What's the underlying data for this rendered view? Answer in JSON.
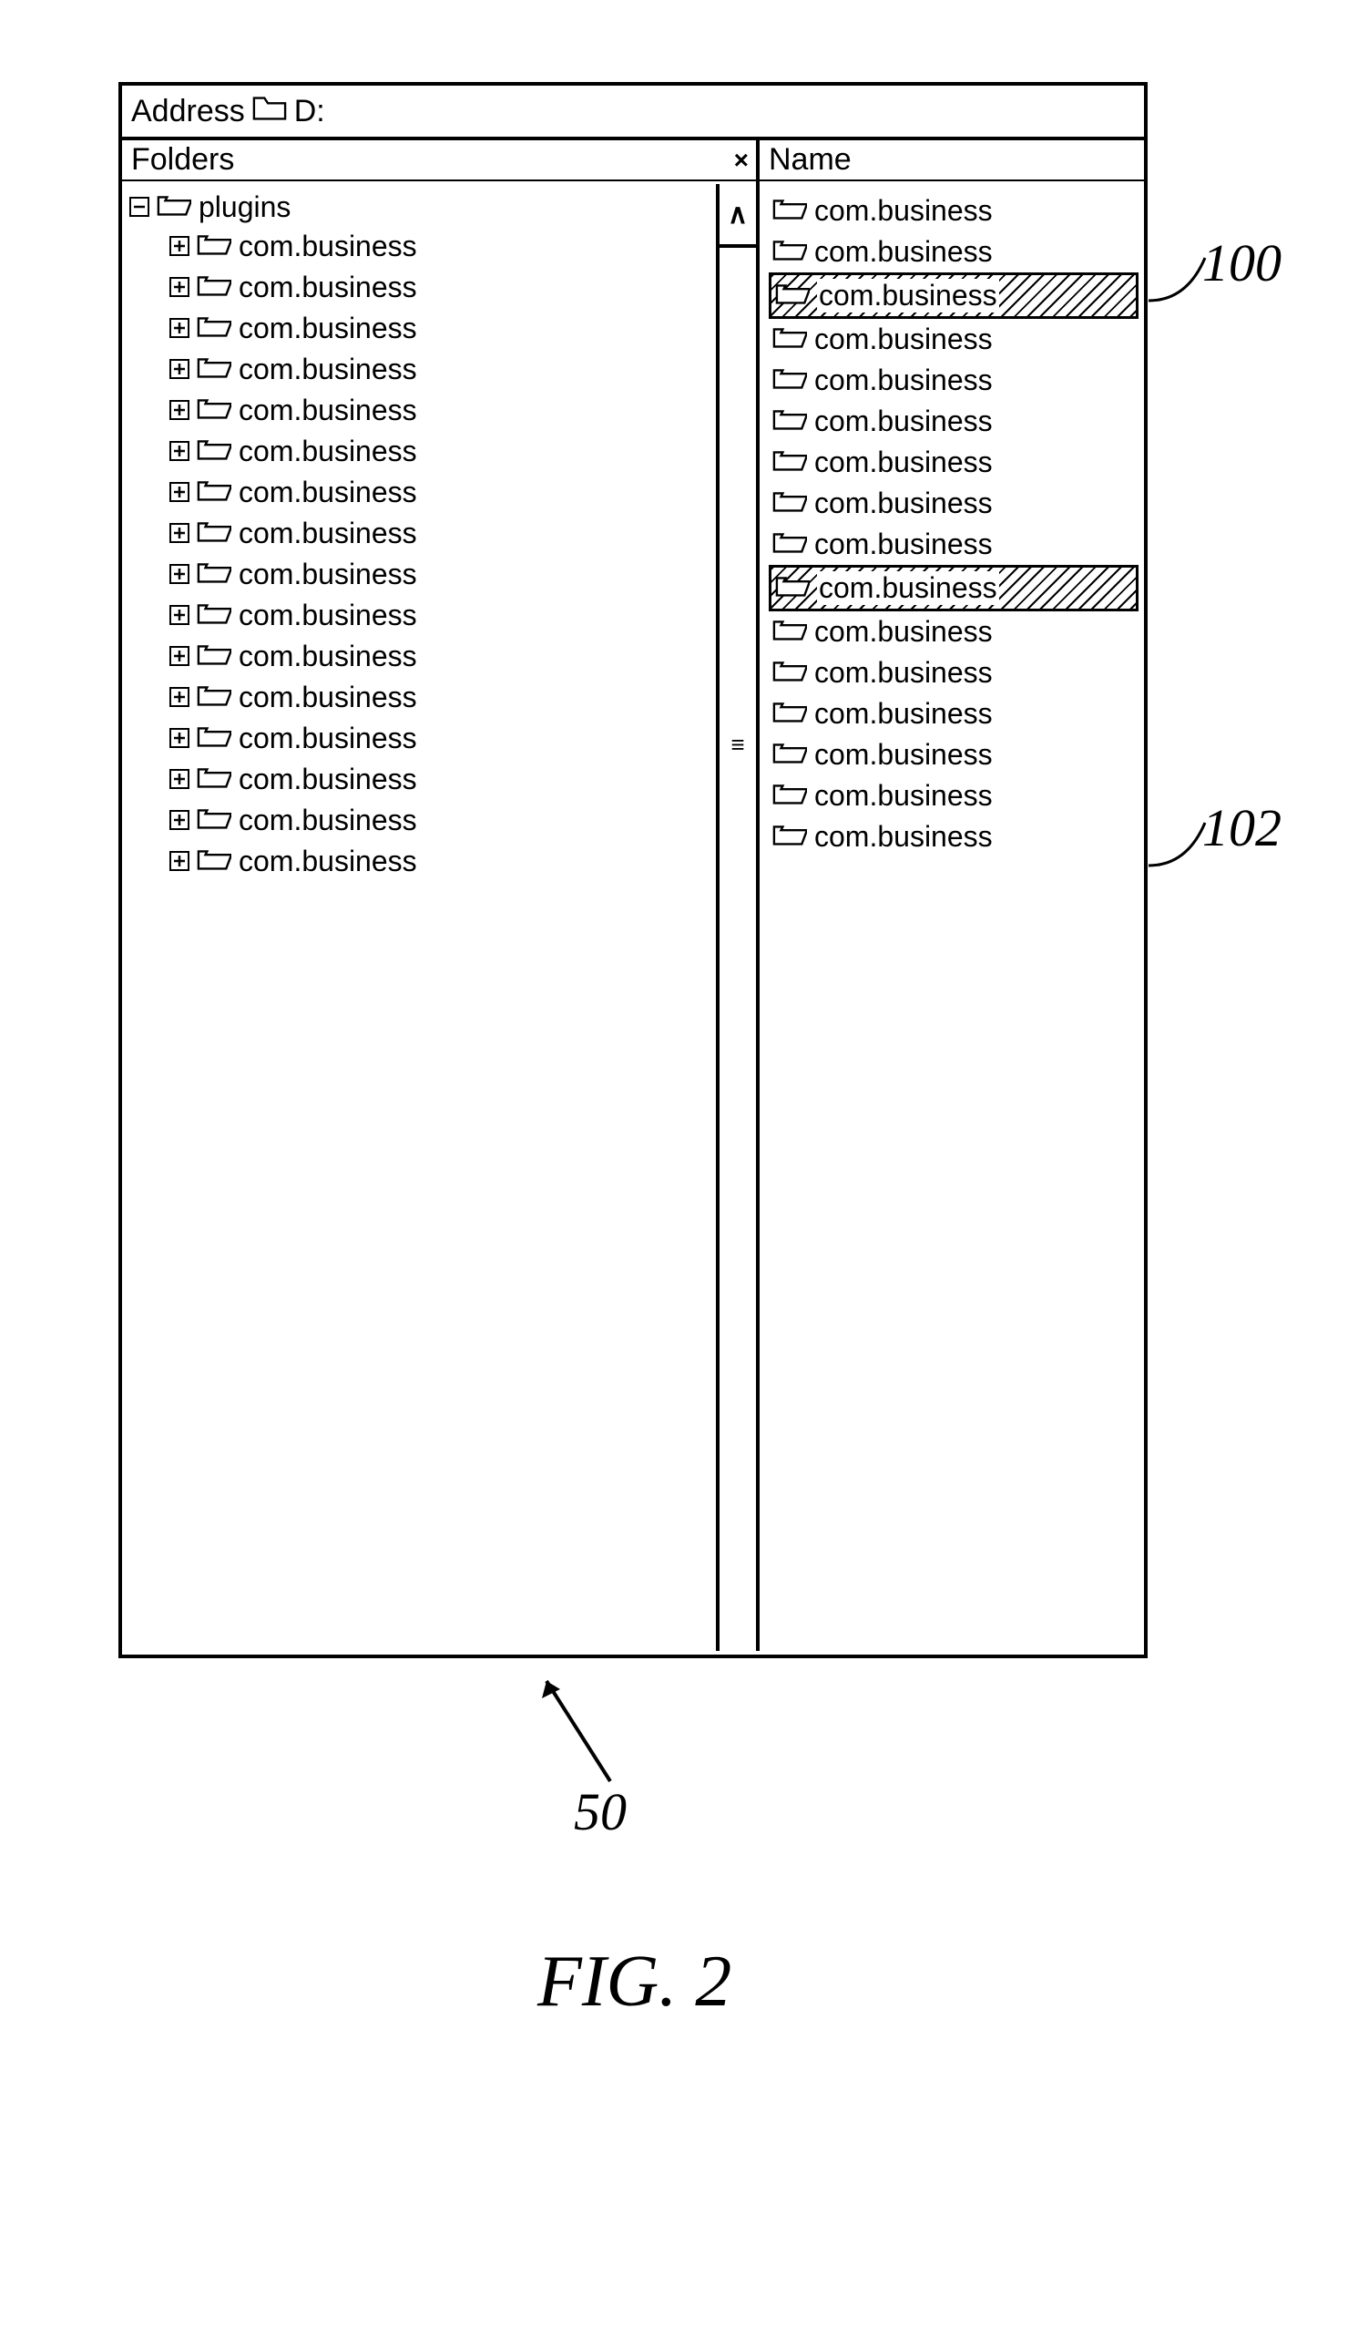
{
  "addressBar": {
    "label": "Address",
    "value": "D:"
  },
  "foldersPane": {
    "header": "Folders",
    "close": "×",
    "root": {
      "name": "plugins",
      "expanded": true
    },
    "children": [
      {
        "name": "com.business"
      },
      {
        "name": "com.business"
      },
      {
        "name": "com.business"
      },
      {
        "name": "com.business"
      },
      {
        "name": "com.business"
      },
      {
        "name": "com.business"
      },
      {
        "name": "com.business"
      },
      {
        "name": "com.business"
      },
      {
        "name": "com.business"
      },
      {
        "name": "com.business"
      },
      {
        "name": "com.business"
      },
      {
        "name": "com.business"
      },
      {
        "name": "com.business"
      },
      {
        "name": "com.business"
      },
      {
        "name": "com.business"
      },
      {
        "name": "com.business"
      }
    ],
    "scroll": {
      "up": "∧",
      "thumb": "≡"
    }
  },
  "contentPane": {
    "header": "Name",
    "rows": [
      {
        "name": "com.business",
        "highlighted": false
      },
      {
        "name": "com.business",
        "highlighted": false
      },
      {
        "name": "com.business",
        "highlighted": true,
        "ref": "100"
      },
      {
        "name": "com.business",
        "highlighted": false
      },
      {
        "name": "com.business",
        "highlighted": false
      },
      {
        "name": "com.business",
        "highlighted": false
      },
      {
        "name": "com.business",
        "highlighted": false
      },
      {
        "name": "com.business",
        "highlighted": false
      },
      {
        "name": "com.business",
        "highlighted": false
      },
      {
        "name": "com.business",
        "highlighted": true,
        "ref": "102"
      },
      {
        "name": "com.business",
        "highlighted": false
      },
      {
        "name": "com.business",
        "highlighted": false
      },
      {
        "name": "com.business",
        "highlighted": false
      },
      {
        "name": "com.business",
        "highlighted": false
      },
      {
        "name": "com.business",
        "highlighted": false
      },
      {
        "name": "com.business",
        "highlighted": false
      }
    ]
  },
  "figure": {
    "id": "50",
    "label": "FIG. 2"
  },
  "refLabels": {
    "r100": "100",
    "r102": "102"
  }
}
